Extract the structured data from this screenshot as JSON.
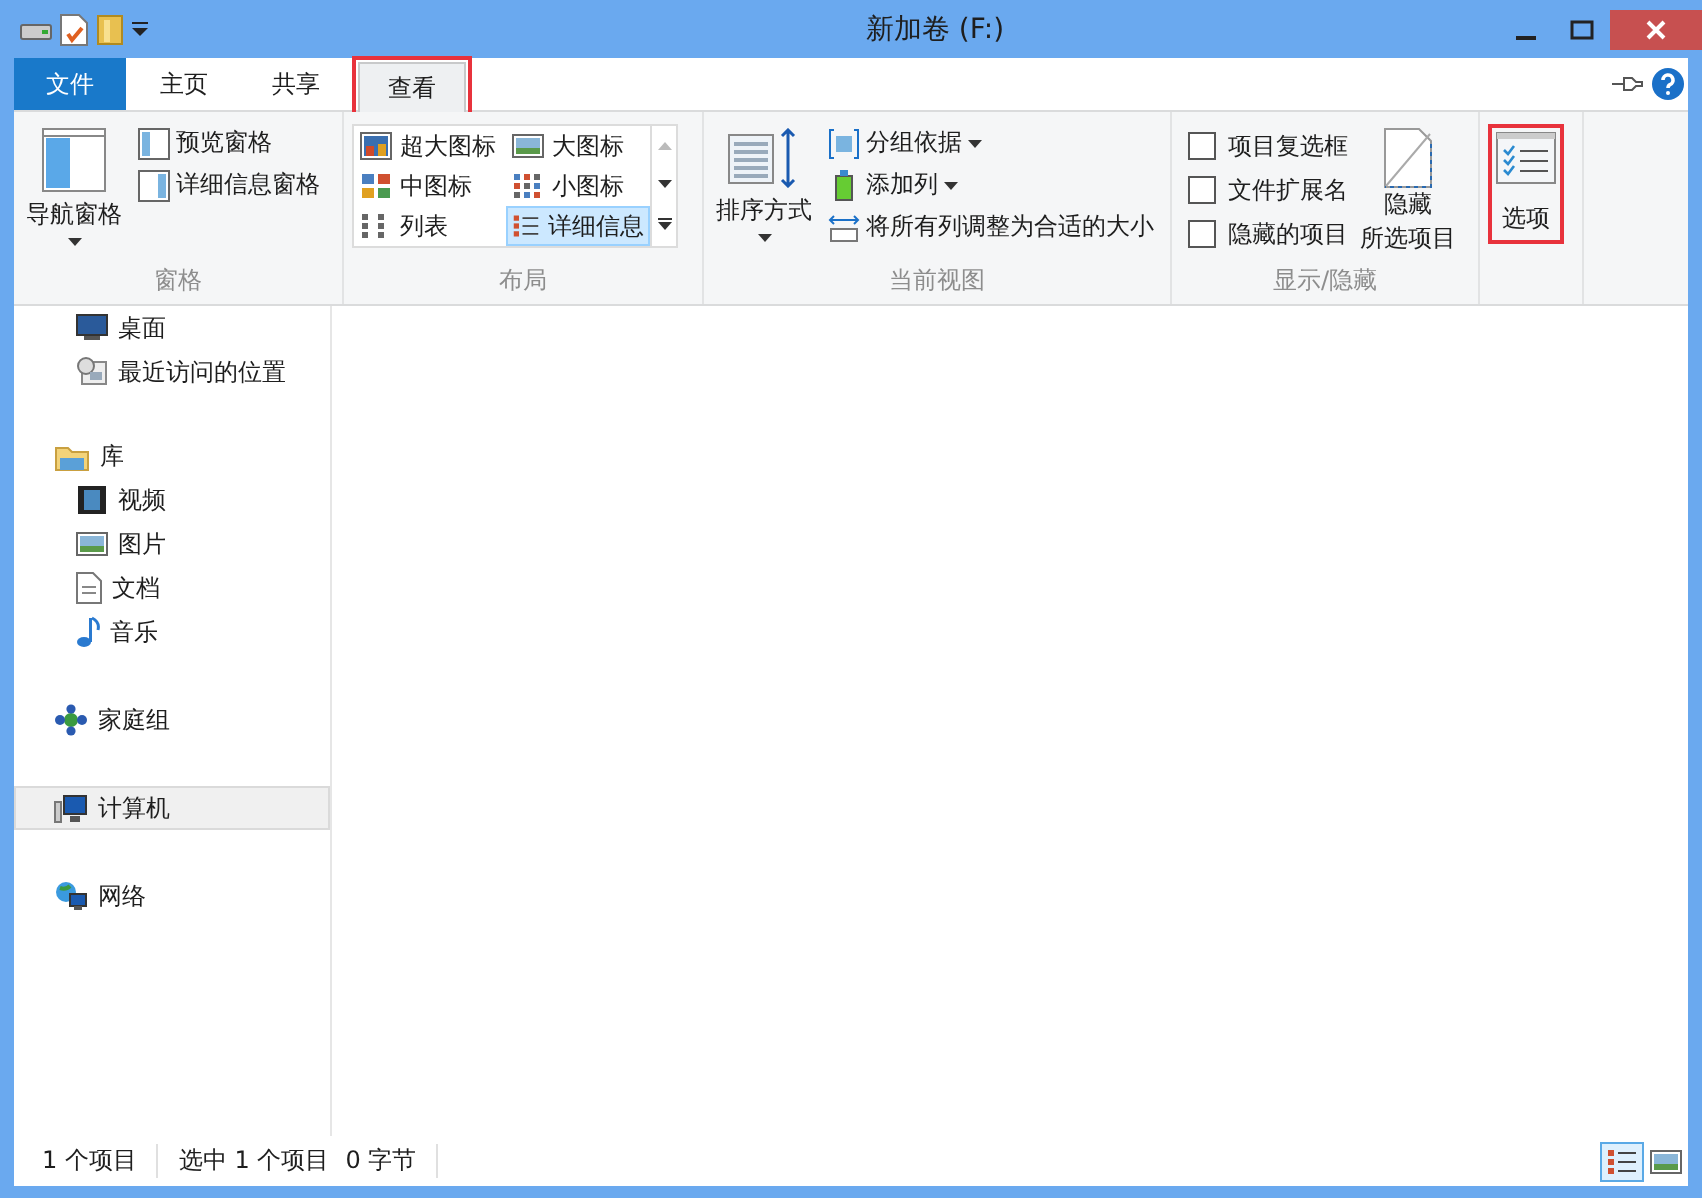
{
  "window": {
    "title": "新加卷 (F:)"
  },
  "tabs": [
    {
      "label": "文件",
      "kind": "file",
      "selected": false,
      "highlighted": false
    },
    {
      "label": "主页",
      "kind": "normal",
      "selected": false,
      "highlighted": false
    },
    {
      "label": "共享",
      "kind": "normal",
      "selected": false,
      "highlighted": false
    },
    {
      "label": "查看",
      "kind": "normal",
      "selected": true,
      "highlighted": true
    }
  ],
  "ribbon": {
    "panes": {
      "label": "窗格",
      "nav_pane": "导航窗格",
      "preview_pane": "预览窗格",
      "details_pane": "详细信息窗格"
    },
    "layout": {
      "label": "布局",
      "options": [
        {
          "label": "超大图标",
          "selected": false
        },
        {
          "label": "大图标",
          "selected": false
        },
        {
          "label": "中图标",
          "selected": false
        },
        {
          "label": "小图标",
          "selected": false
        },
        {
          "label": "列表",
          "selected": false
        },
        {
          "label": "详细信息",
          "selected": true
        }
      ]
    },
    "current_view": {
      "label": "当前视图",
      "sort_by": "排序方式",
      "group_by": "分组依据",
      "add_columns": "添加列",
      "size_columns": "将所有列调整为合适的大小"
    },
    "show_hide": {
      "label": "显示/隐藏",
      "checkboxes": [
        {
          "label": "项目复选框",
          "checked": false
        },
        {
          "label": "文件扩展名",
          "checked": false
        },
        {
          "label": "隐藏的项目",
          "checked": false
        }
      ],
      "hide_selected": [
        "隐藏",
        "所选项目"
      ]
    },
    "options": {
      "label": "选项",
      "highlighted": true
    }
  },
  "nav_pane": {
    "favorites_children": [
      {
        "label": "桌面",
        "selected": false
      },
      {
        "label": "最近访问的位置",
        "selected": false
      }
    ],
    "tree": [
      {
        "label": "库",
        "selected": false,
        "children": [
          {
            "label": "视频",
            "selected": false
          },
          {
            "label": "图片",
            "selected": false
          },
          {
            "label": "文档",
            "selected": false
          },
          {
            "label": "音乐",
            "selected": false
          }
        ]
      },
      {
        "label": "家庭组",
        "selected": false
      },
      {
        "label": "计算机",
        "selected": true
      },
      {
        "label": "网络",
        "selected": false
      }
    ]
  },
  "status_bar": {
    "item_count": "1 个项目",
    "selection": "选中 1 个项目",
    "size": "0 字节",
    "view_buttons": [
      {
        "kind": "details",
        "selected": true
      },
      {
        "kind": "thumbnails",
        "selected": false
      }
    ]
  }
}
